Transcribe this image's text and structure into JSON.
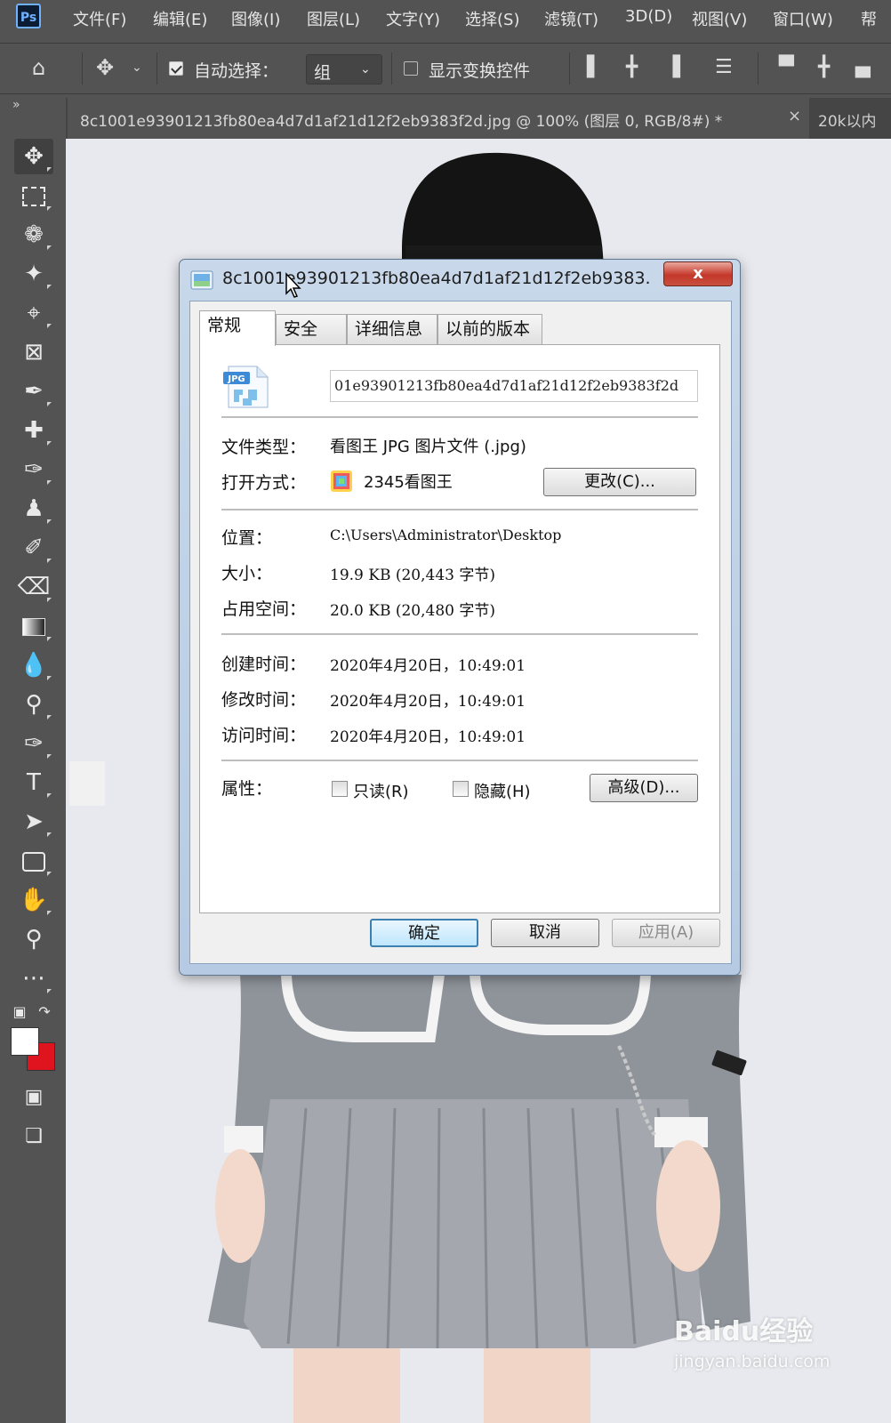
{
  "app": {
    "logo": "Ps"
  },
  "menu": [
    "文件(F)",
    "编辑(E)",
    "图像(I)",
    "图层(L)",
    "文字(Y)",
    "选择(S)",
    "滤镜(T)",
    "3D(D)",
    "视图(V)",
    "窗口(W)",
    "帮"
  ],
  "options_bar": {
    "auto_select_label": "自动选择：",
    "auto_select_checked": true,
    "group_value": "组",
    "show_transform_label": "显示变换控件",
    "show_transform_checked": false
  },
  "document_tabs": [
    {
      "label": "8c1001e93901213fb80ea4d7d1af21d12f2eb9383f2d.jpg @ 100% (图层 0, RGB/8#) *",
      "close": "×"
    },
    {
      "label": "20k以内"
    }
  ],
  "colors": {
    "foreground": "#ffffff",
    "background": "#e0141e"
  },
  "tools": [
    "move-tool",
    "marquee-tool",
    "lasso-tool",
    "magic-wand-tool",
    "crop-tool",
    "frame-tool",
    "eyedropper-tool",
    "healing-brush-tool",
    "brush-tool",
    "stamp-tool",
    "history-brush-tool",
    "eraser-tool",
    "gradient-tool",
    "blur-tool",
    "dodge-tool",
    "pen-tool",
    "type-tool",
    "path-selection-tool",
    "rectangle-tool",
    "hand-tool",
    "zoom-tool",
    "more-tools"
  ],
  "dialog": {
    "title": "8c1001e93901213fb80ea4d7d1af21d12f2eb9383...",
    "close": "x",
    "tabs": [
      "常规",
      "安全",
      "详细信息",
      "以前的版本"
    ],
    "active_tab": "常规",
    "file_icon_text": "JPG",
    "filename": "01e93901213fb80ea4d7d1af21d12f2eb9383f2d",
    "fields": {
      "type_label": "文件类型：",
      "type_value": "看图王 JPG 图片文件 (.jpg)",
      "open_with_label": "打开方式：",
      "open_with_value": "2345看图王",
      "change_button": "更改(C)...",
      "location_label": "位置：",
      "location_value": "C:\\Users\\Administrator\\Desktop",
      "size_label": "大小：",
      "size_value": "19.9 KB (20,443 字节)",
      "disk_label": "占用空间：",
      "disk_value": "20.0 KB (20,480 字节)",
      "created_label": "创建时间：",
      "created_value": "2020年4月20日，10:49:01",
      "modified_label": "修改时间：",
      "modified_value": "2020年4月20日，10:49:01",
      "accessed_label": "访问时间：",
      "accessed_value": "2020年4月20日，10:49:01",
      "attributes_label": "属性：",
      "readonly_label": "只读(R)",
      "readonly_checked": false,
      "hidden_label": "隐藏(H)",
      "hidden_checked": false,
      "advanced_button": "高级(D)..."
    },
    "buttons": {
      "ok": "确定",
      "cancel": "取消",
      "apply": "应用(A)"
    }
  },
  "watermark": {
    "main": "Baidu经验",
    "url": "jingyan.baidu.com"
  }
}
